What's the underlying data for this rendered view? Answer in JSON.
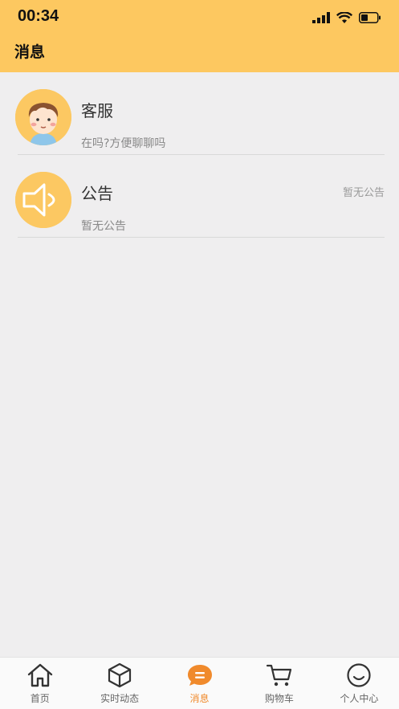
{
  "status_bar": {
    "time": "00:34"
  },
  "header": {
    "title": "消息"
  },
  "messages": [
    {
      "name": "客服",
      "preview": "在吗?方便聊聊吗",
      "aside": ""
    },
    {
      "name": "公告",
      "preview": "暂无公告",
      "aside": "暂无公告"
    }
  ],
  "tabs": [
    {
      "label": "首页",
      "icon": "home-icon"
    },
    {
      "label": "实时动态",
      "icon": "cube-icon"
    },
    {
      "label": "消息",
      "icon": "chat-icon",
      "active": true
    },
    {
      "label": "购物车",
      "icon": "cart-icon"
    },
    {
      "label": "个人中心",
      "icon": "smile-icon"
    }
  ],
  "colors": {
    "header": "#fdc860",
    "accent": "#f08a2c",
    "background": "#efeeef"
  }
}
